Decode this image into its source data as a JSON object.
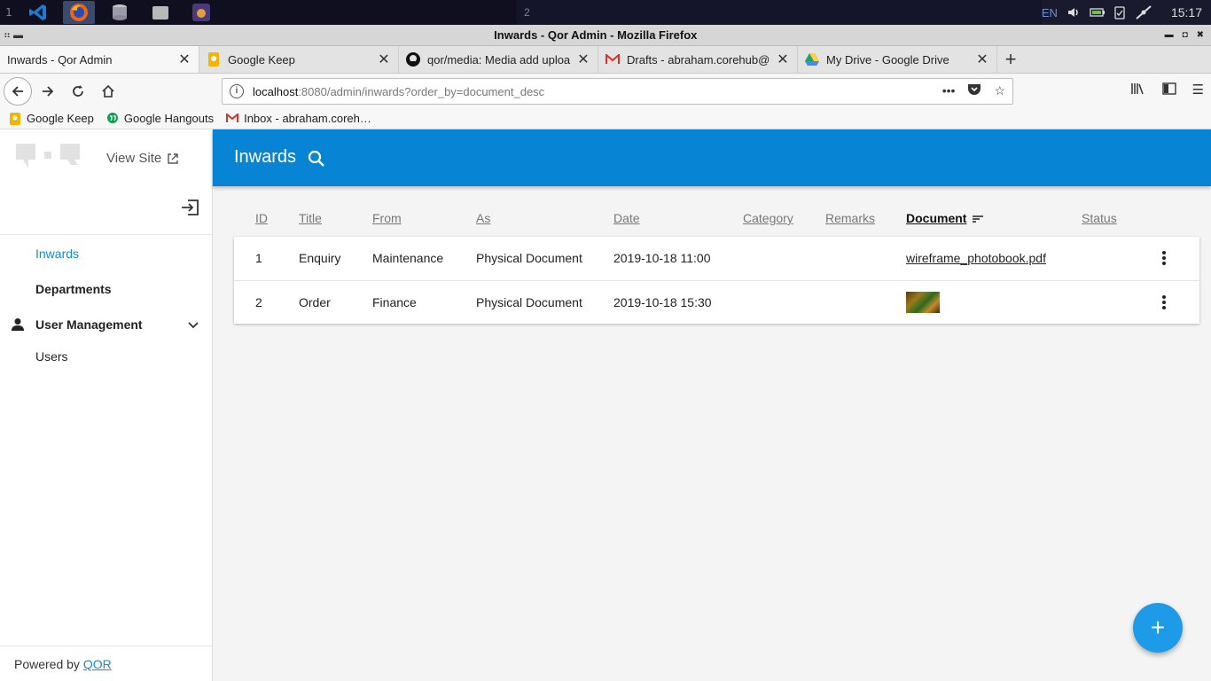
{
  "taskbar": {
    "workspace_left": "1",
    "workspace_right": "2",
    "language": "EN",
    "clock": "15:17",
    "apps": [
      {
        "name": "vscode-icon",
        "color": "#1f7bd0"
      },
      {
        "name": "firefox-icon",
        "color": "#e8661c"
      },
      {
        "name": "database-icon",
        "color": "#9a9aa8"
      },
      {
        "name": "folder-icon",
        "color": "#b8b8b8"
      },
      {
        "name": "game-icon",
        "color": "#6a4a9a"
      }
    ]
  },
  "window": {
    "title": "Inwards - Qor Admin - Mozilla Firefox"
  },
  "tabs": [
    {
      "label": "Inwards - Qor Admin",
      "icon": "none",
      "active": true
    },
    {
      "label": "Google Keep",
      "icon": "keep-icon",
      "active": false
    },
    {
      "label": "qor/media: Media add uploa",
      "icon": "github-icon",
      "active": false
    },
    {
      "label": "Drafts - abraham.corehub@",
      "icon": "gmail-icon",
      "active": false
    },
    {
      "label": "My Drive - Google Drive",
      "icon": "drive-icon",
      "active": false
    }
  ],
  "urlbar": {
    "host": "localhost",
    "rest": ":8080/admin/inwards?order_by=document_desc"
  },
  "bookmarks": [
    {
      "label": "Google Keep",
      "icon": "keep-icon"
    },
    {
      "label": "Google Hangouts",
      "icon": "hangouts-icon"
    },
    {
      "label": "Inbox - abraham.coreh…",
      "icon": "gmail-icon"
    }
  ],
  "sidebar": {
    "view_site": "View Site",
    "menu": {
      "inwards": "Inwards",
      "departments": "Departments",
      "user_management": "User Management",
      "users": "Users"
    },
    "powered_prefix": "Powered by",
    "powered_link": "QOR"
  },
  "header": {
    "title": "Inwards"
  },
  "table": {
    "columns": {
      "id": "ID",
      "title": "Title",
      "from": "From",
      "as": "As",
      "date": "Date",
      "category": "Category",
      "remarks": "Remarks",
      "document": "Document",
      "status": "Status"
    },
    "sorted_column": "Document",
    "rows": [
      {
        "id": "1",
        "title": "Enquiry",
        "from": "Maintenance",
        "as": "Physical Document",
        "date": "2019-10-18 11:00",
        "category": "",
        "remarks": "",
        "document": "wireframe_photobook.pdf",
        "status": ""
      },
      {
        "id": "2",
        "title": "Order",
        "from": "Finance",
        "as": "Physical Document",
        "date": "2019-10-18 15:30",
        "category": "",
        "remarks": "",
        "document": "",
        "document_thumb": "image-thumbnail",
        "status": ""
      }
    ]
  },
  "fab": {
    "label": "+"
  }
}
